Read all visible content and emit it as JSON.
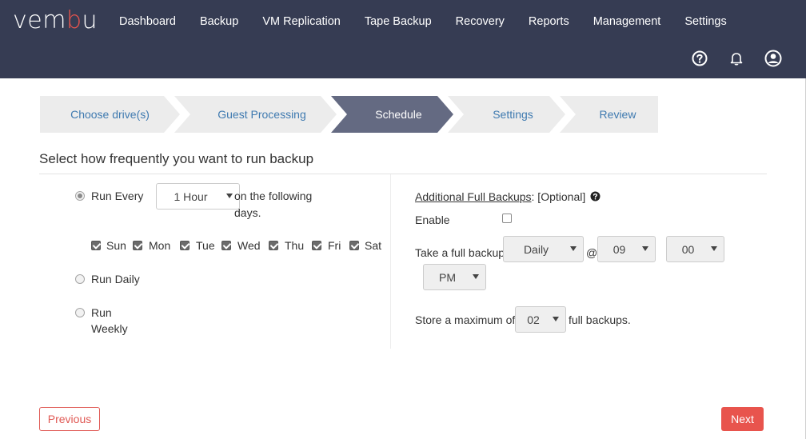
{
  "colors": {
    "header_bg": "#363c53",
    "accent": "#e8544d",
    "link": "#3f7ab0",
    "step_active": "#646a82",
    "step_inactive": "#ececec"
  },
  "header": {
    "logo_prefix": "vem",
    "logo_accent": "b",
    "logo_suffix": "u",
    "nav": [
      "Dashboard",
      "Backup",
      "VM Replication",
      "Tape Backup",
      "Recovery",
      "Reports",
      "Management",
      "Settings"
    ],
    "icons": [
      "help-icon",
      "bell-icon",
      "user-icon"
    ]
  },
  "wizard": {
    "steps": [
      "Choose drive(s)",
      "Guest Processing",
      "Schedule",
      "Settings",
      "Review"
    ],
    "active": "Schedule"
  },
  "schedule": {
    "title": "Select how frequently you want to run backup",
    "run_every_label": "Run Every",
    "interval_value": "1 Hour",
    "following_days_line1": "on the following",
    "following_days_line2": "days.",
    "days": [
      "Sun",
      "Mon",
      "Tue",
      "Wed",
      "Thu",
      "Fri",
      "Sat"
    ],
    "run_daily_label": "Run Daily",
    "run_weekly_line1": "Run",
    "run_weekly_line2": "Weekly"
  },
  "full_backups": {
    "heading": "Additional Full Backups",
    "optional": ": [Optional]",
    "enable_label": "Enable",
    "take_label": "Take a full backup",
    "frequency_value": "Daily",
    "at_symbol": "@",
    "hour_value": "09",
    "minute_value": "00",
    "ampm_value": "PM",
    "store_prefix": "Store a maximum of",
    "max_value": "02",
    "store_suffix": "full backups."
  },
  "footer": {
    "previous": "Previous",
    "next": "Next"
  }
}
